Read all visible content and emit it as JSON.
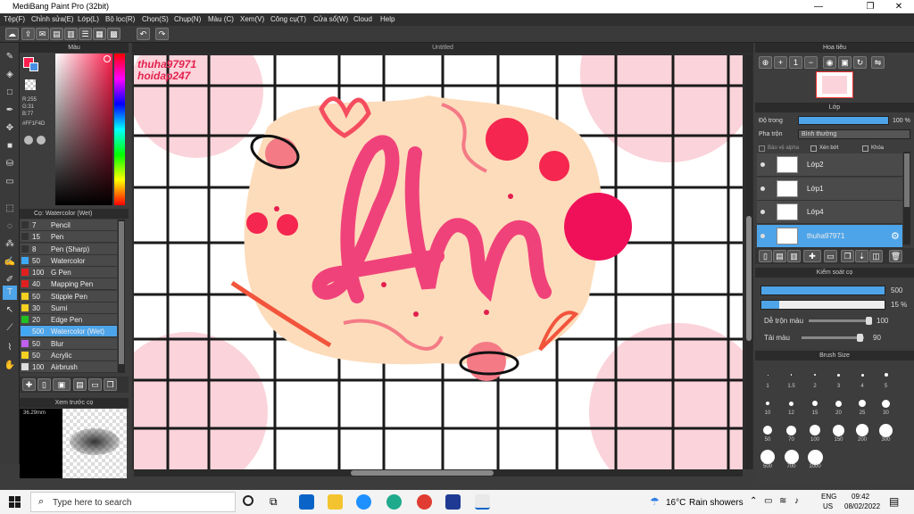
{
  "window": {
    "title": "MediBang Paint Pro (32bit)"
  },
  "menu": [
    "Tệp(F)",
    "Chỉnh sửa(E)",
    "Lớp(L)",
    "Bộ lọc(R)",
    "Chọn(S)",
    "Chụp(N)",
    "Màu (C)",
    "Xem(V)",
    "Công cụ(T)",
    "Cửa sổ(W)",
    "Cloud",
    "Help"
  ],
  "canvas": {
    "tab_title": "Untitled",
    "watermark1": "thuha97971",
    "watermark2": "hoidap247"
  },
  "color_panel": {
    "title": "Màu",
    "r": "R:255",
    "g": "G:31",
    "b": "B:77",
    "hex": "#FF1F4D",
    "primary": "#ff1f4d"
  },
  "brush_panel": {
    "title": "Cọ: Watercolor (Wet)",
    "items": [
      {
        "size": "7",
        "name": "Pencil",
        "color": "#333333"
      },
      {
        "size": "15",
        "name": "Pen",
        "color": "#333333"
      },
      {
        "size": "8",
        "name": "Pen (Sharp)",
        "color": "#333333"
      },
      {
        "size": "50",
        "name": "Watercolor",
        "color": "#3fa9f5"
      },
      {
        "size": "100",
        "name": "G Pen",
        "color": "#e02020"
      },
      {
        "size": "40",
        "name": "Mapping Pen",
        "color": "#e02020"
      },
      {
        "size": "50",
        "name": "Stipple Pen",
        "color": "#f5d020"
      },
      {
        "size": "30",
        "name": "Sumi",
        "color": "#f5d020"
      },
      {
        "size": "20",
        "name": "Edge Pen",
        "color": "#20c020"
      },
      {
        "size": "500",
        "name": "Watercolor (Wet)",
        "color": "#3fa9f5"
      },
      {
        "size": "50",
        "name": "Blur",
        "color": "#c060f0"
      },
      {
        "size": "50",
        "name": "Acrylic",
        "color": "#f5d020"
      },
      {
        "size": "100",
        "name": "Airbrush",
        "color": "#dddddd"
      }
    ]
  },
  "preview_panel": {
    "title": "Xem trước cọ",
    "size": "36.29mm"
  },
  "navigator": {
    "title": "Hoa tiêu"
  },
  "layer_panel": {
    "title": "Lớp",
    "opacity_label": "Độ trong",
    "opacity_value": "100 %",
    "blend_label": "Pha trộn",
    "blend_value": "Bình thường",
    "protect_alpha": "Bảo vệ alpha",
    "clipping": "Xén bớt",
    "lock": "Khóa",
    "layers": [
      {
        "name": "Lớp2"
      },
      {
        "name": "Lớp1"
      },
      {
        "name": "Lớp4"
      },
      {
        "name": "thuha97971"
      }
    ]
  },
  "brush_control": {
    "title": "Kiểm soát cọ",
    "size_value": "500",
    "opacity_value": "15 %",
    "blend_label": "Dễ trộn màu",
    "blend_value": "100",
    "reload_label": "Tải màu",
    "reload_value": "90"
  },
  "brush_size": {
    "title": "Brush Size",
    "sizes": [
      "1",
      "1.5",
      "2",
      "3",
      "4",
      "5",
      "10",
      "12",
      "15",
      "20",
      "25",
      "30",
      "50",
      "70",
      "100",
      "150",
      "200",
      "300",
      "500",
      "700",
      "1000"
    ]
  },
  "taskbar": {
    "search_placeholder": "Type here to search",
    "weather_temp": "16°C",
    "weather_text": "Rain showers",
    "lang1": "ENG",
    "lang2": "US",
    "time": "09:42",
    "date": "08/02/2022"
  }
}
